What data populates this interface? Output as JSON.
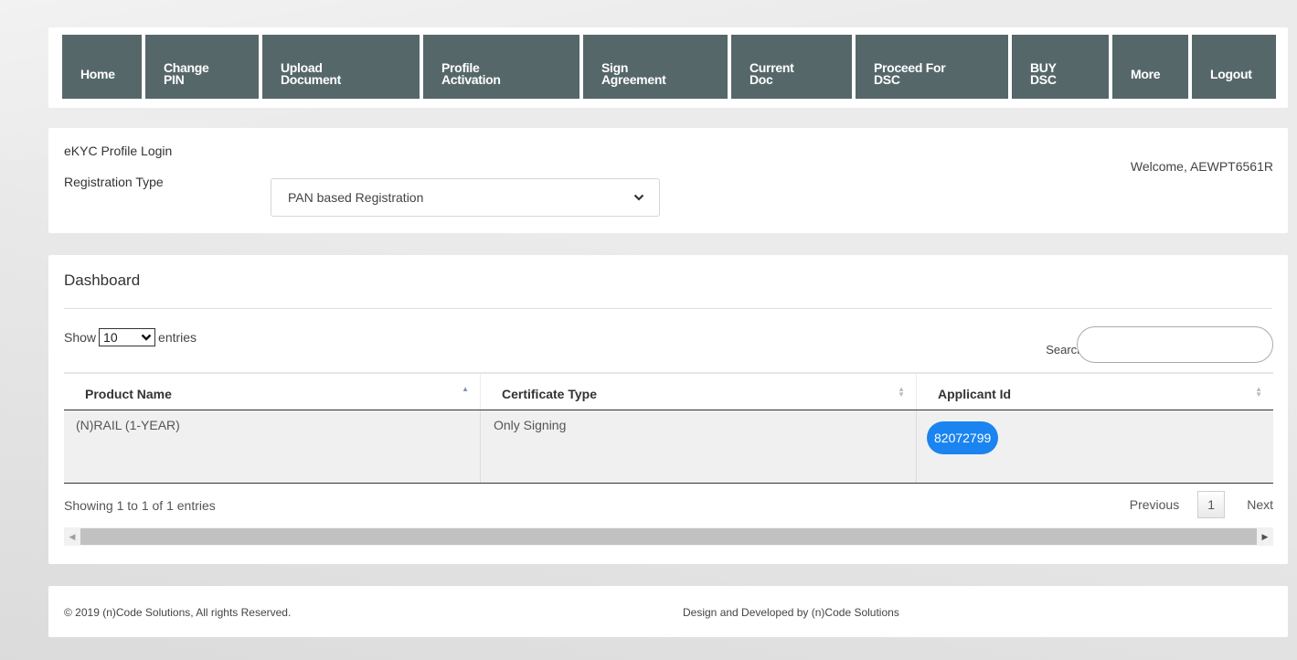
{
  "nav": {
    "home": "Home",
    "change_pin": "Change\nPIN",
    "upload_document": "Upload\nDocument",
    "profile_activation": "Profile\nActivation",
    "sign_agreement": "Sign\nAgreement",
    "current_doc": "Current\nDoc",
    "proceed_for_dsc": "Proceed For\nDSC",
    "buy_dsc": "BUY\nDSC",
    "more": "More",
    "logout": "Logout"
  },
  "profile": {
    "title": "eKYC Profile Login",
    "registration_label": "Registration Type",
    "registration_value": "PAN based Registration",
    "welcome": "Welcome, AEWPT6561R"
  },
  "dashboard": {
    "title": "Dashboard",
    "show_label": "Show",
    "length_value": "10",
    "entries_label": "entries",
    "search_label": "Search:",
    "search_value": "",
    "columns": [
      "Product Name",
      "Certificate Type",
      "Applicant Id"
    ],
    "rows": [
      {
        "product_name": "(N)RAIL (1-YEAR)",
        "certificate_type": "Only Signing",
        "applicant_id": "82072799"
      }
    ],
    "info": "Showing 1 to 1 of 1 entries",
    "pager": {
      "previous": "Previous",
      "current": "1",
      "next": "Next"
    }
  },
  "footer": {
    "copyright": "© 2019 (n)Code Solutions, All rights Reserved.",
    "design": "Design and Developed by (n)Code Solutions"
  },
  "colors": {
    "nav_bg": "#56676a",
    "badge_bg": "#1a84f0",
    "page_bg": "#e9e9e9"
  }
}
